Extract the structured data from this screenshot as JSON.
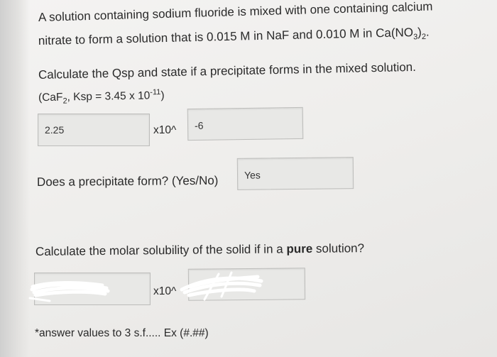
{
  "question": {
    "line1": "A solution containing sodium fluoride is mixed with one containing calcium",
    "line2": "nitrate to form a solution that is 0.015 M in NaF and 0.010 M in Ca(NO3)2."
  },
  "part1": {
    "line1": "Calculate the Qsp and state if a precipitate forms in the mixed solution.",
    "line2": "(CaF2, Ksp = 3.45 x 10-11)",
    "coefficient_value": "2.25",
    "times_ten_label": "x10^",
    "exponent_value": "-6"
  },
  "part2": {
    "prompt": "Does a precipitate form? (Yes/No)",
    "answer_value": "Yes"
  },
  "part3": {
    "prompt_before": "Calculate the molar solubility of the solid if in a",
    "prompt_bold": "pure",
    "prompt_after": "solution?",
    "times_ten_label": "x10^"
  },
  "footnote": "*answer values to 3 s.f..... Ex (#.##)"
}
